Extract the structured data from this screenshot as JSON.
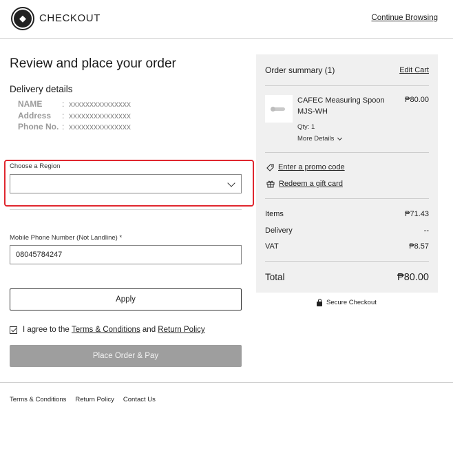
{
  "header": {
    "brand": "CHECKOUT",
    "continue_label": "Continue Browsing"
  },
  "main": {
    "title": "Review and place your order",
    "delivery_heading": "Delivery details",
    "delivery": [
      {
        "label": "NAME",
        "value": "xxxxxxxxxxxxxxx"
      },
      {
        "label": "Address",
        "value": "xxxxxxxxxxxxxxx"
      },
      {
        "label": "Phone No.",
        "value": "xxxxxxxxxxxxxxx"
      }
    ],
    "region": {
      "label": "Choose a Region",
      "value": ""
    },
    "phone": {
      "label": "Mobile Phone Number (Not Landline) *",
      "value": "08045784247"
    },
    "apply_label": "Apply",
    "agree": {
      "prefix": "I agree to the",
      "terms": "Terms & Conditions",
      "and": "and",
      "policy": "Return Policy",
      "checked": true
    },
    "place_label": "Place Order & Pay"
  },
  "summary": {
    "title": "Order summary (1)",
    "edit_label": "Edit Cart",
    "product": {
      "name": "CAFEC Measuring Spoon MJS-WH",
      "price": "₱80.00",
      "qty": "Qty: 1",
      "more": "More Details"
    },
    "promo_label": "Enter a promo code",
    "gift_label": "Redeem a gift card",
    "lines": [
      {
        "label": "Items",
        "value": "₱71.43"
      },
      {
        "label": "Delivery",
        "value": "--"
      },
      {
        "label": "VAT",
        "value": "₱8.57"
      }
    ],
    "total_label": "Total",
    "total_value": "₱80.00"
  },
  "secure_label": "Secure Checkout",
  "footer": {
    "links": [
      "Terms & Conditions",
      "Return Policy",
      "Contact Us"
    ]
  },
  "colors": {
    "highlight": "#e0262e",
    "summary_bg": "#f0f0f0",
    "disabled_button": "#9e9e9e"
  }
}
